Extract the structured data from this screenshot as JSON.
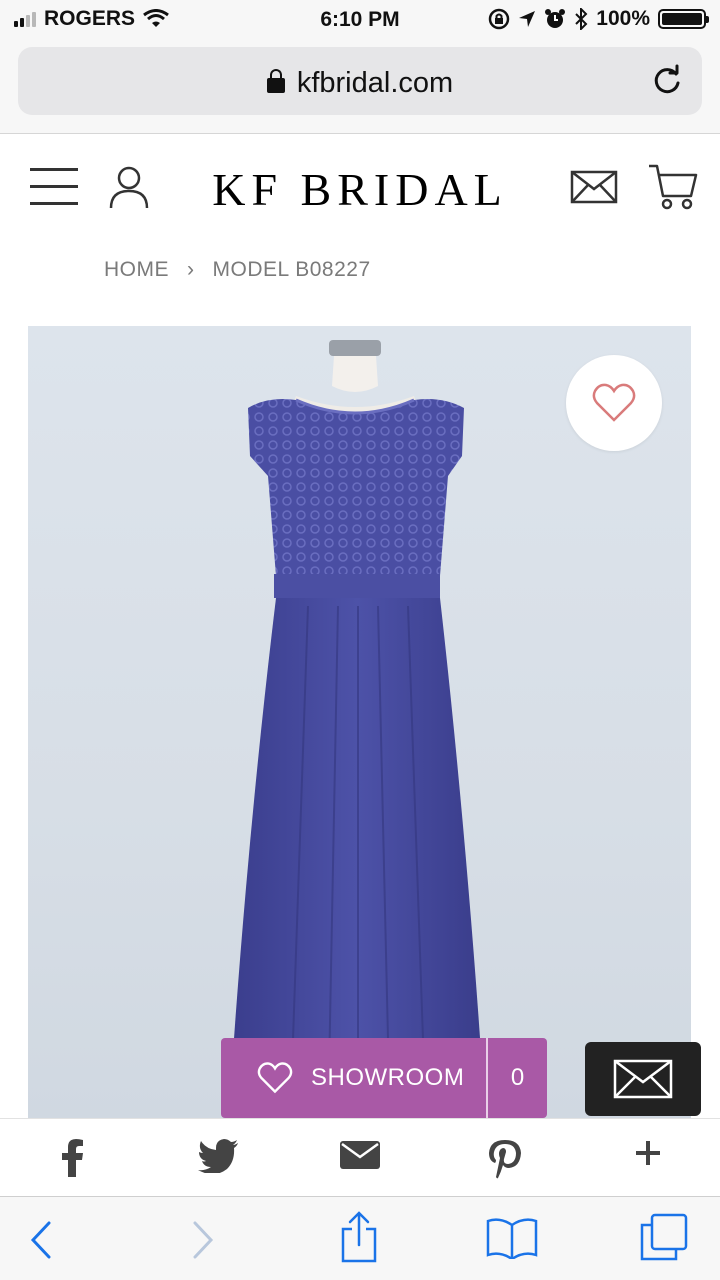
{
  "status": {
    "carrier": "ROGERS",
    "time": "6:10 PM",
    "battery": "100%",
    "battery_level": 1.0
  },
  "browser": {
    "url": "kfbridal.com"
  },
  "header": {
    "logo": "KF BRIDAL"
  },
  "breadcrumb": {
    "items": [
      "HOME",
      "MODEL B08227"
    ],
    "separator": "›"
  },
  "product": {
    "dress_color": "#46499a",
    "background_color": "#dbe2ea"
  },
  "showroom": {
    "label": "SHOWROOM",
    "count": "0",
    "color": "#a959a6"
  },
  "share": {
    "icons": [
      "facebook-icon",
      "twitter-icon",
      "email-icon",
      "pinterest-icon",
      "plus-icon"
    ]
  },
  "toolbar": {
    "icons": [
      "back-icon",
      "forward-icon",
      "share-icon",
      "bookmarks-icon",
      "tabs-icon"
    ],
    "accent": "#1a73e8"
  }
}
